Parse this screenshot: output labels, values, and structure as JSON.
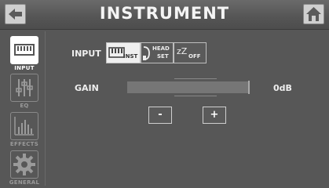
{
  "header": {
    "title": "INSTRUMENT",
    "back_icon": "arrow-left-icon",
    "home_icon": "home-icon"
  },
  "sidebar": {
    "items": [
      {
        "label": "INPUT",
        "icon": "keyboard-icon",
        "active": true
      },
      {
        "label": "EQ",
        "icon": "eq-sliders-icon",
        "active": false
      },
      {
        "label": "EFFECTS",
        "icon": "effects-bars-icon",
        "active": false
      },
      {
        "label": "GENERAL",
        "icon": "gear-icon",
        "active": false
      }
    ]
  },
  "input": {
    "label": "INPUT",
    "options": [
      {
        "label": "INST",
        "icon": "keyboard-icon",
        "selected": true
      },
      {
        "label_top": "HEAD",
        "label_bottom": "SET",
        "icon": "headset-icon",
        "selected": false
      },
      {
        "label_prefix": "zZ",
        "label": "OFF",
        "icon": "sleep-icon",
        "selected": false
      }
    ]
  },
  "gain": {
    "label": "GAIN",
    "value": "0dB",
    "minus_label": "-",
    "plus_label": "+"
  },
  "colors": {
    "background": "#575757",
    "active": "#efefef",
    "text": "#ffffff"
  }
}
